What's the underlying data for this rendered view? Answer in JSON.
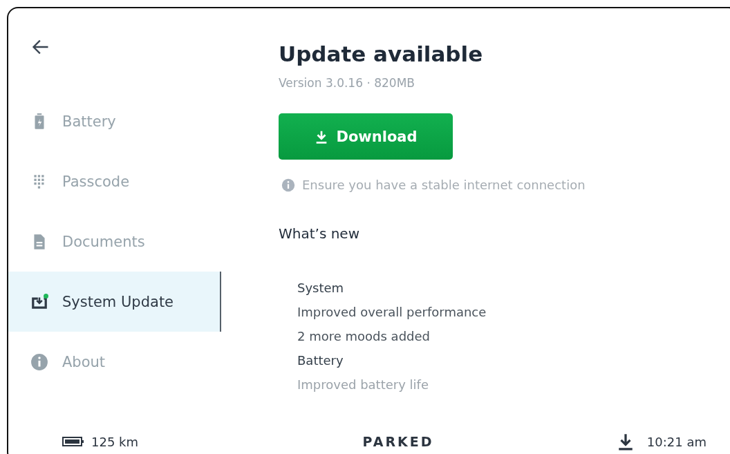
{
  "sidebar": {
    "items": [
      {
        "label": "Battery",
        "kind": "battery",
        "selected": false
      },
      {
        "label": "Passcode",
        "kind": "keypad",
        "selected": false
      },
      {
        "label": "Documents",
        "kind": "document",
        "selected": false
      },
      {
        "label": "System Update",
        "kind": "update",
        "selected": true,
        "badge": true
      },
      {
        "label": "About",
        "kind": "info",
        "selected": false
      }
    ]
  },
  "update": {
    "title": "Update available",
    "version": "Version 3.0.16 · 820MB",
    "button": "Download",
    "note": "Ensure you have a stable internet connection"
  },
  "whats_new": {
    "heading": "What’s new",
    "sections": [
      {
        "title": "System",
        "items": [
          "Improved overall performance",
          "2 more moods added"
        ]
      },
      {
        "title": "Battery",
        "items": [
          "Improved battery life"
        ]
      }
    ]
  },
  "status_bar": {
    "range": "125 km",
    "mode": "PARKED",
    "time": "10:21 am"
  }
}
